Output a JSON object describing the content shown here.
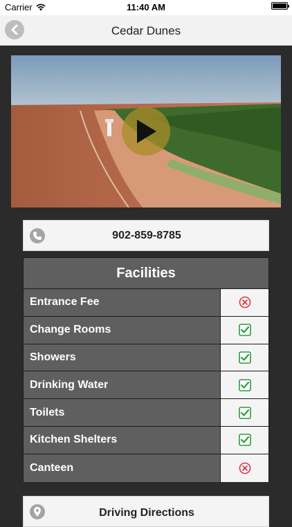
{
  "status_bar": {
    "carrier": "Carrier",
    "time": "11:40 AM",
    "battery_level": 1.0
  },
  "nav": {
    "title": "Cedar Dunes",
    "back_icon": "chevron-left-icon"
  },
  "video": {
    "play_icon": "play-icon"
  },
  "contact": {
    "phone": "902-859-8785",
    "icon": "phone-icon"
  },
  "facilities": {
    "title": "Facilities",
    "items": [
      {
        "label": "Entrance Fee",
        "available": false
      },
      {
        "label": "Change Rooms",
        "available": true
      },
      {
        "label": "Showers",
        "available": true
      },
      {
        "label": "Drinking Water",
        "available": true
      },
      {
        "label": "Toilets",
        "available": true
      },
      {
        "label": "Kitchen Shelters",
        "available": true
      },
      {
        "label": "Canteen",
        "available": false
      }
    ]
  },
  "directions": {
    "label": "Driving Directions",
    "icon": "map-pin-icon"
  },
  "colors": {
    "check": "#2e9a3e",
    "cross": "#d9333f",
    "panel": "#5f5f5f"
  }
}
